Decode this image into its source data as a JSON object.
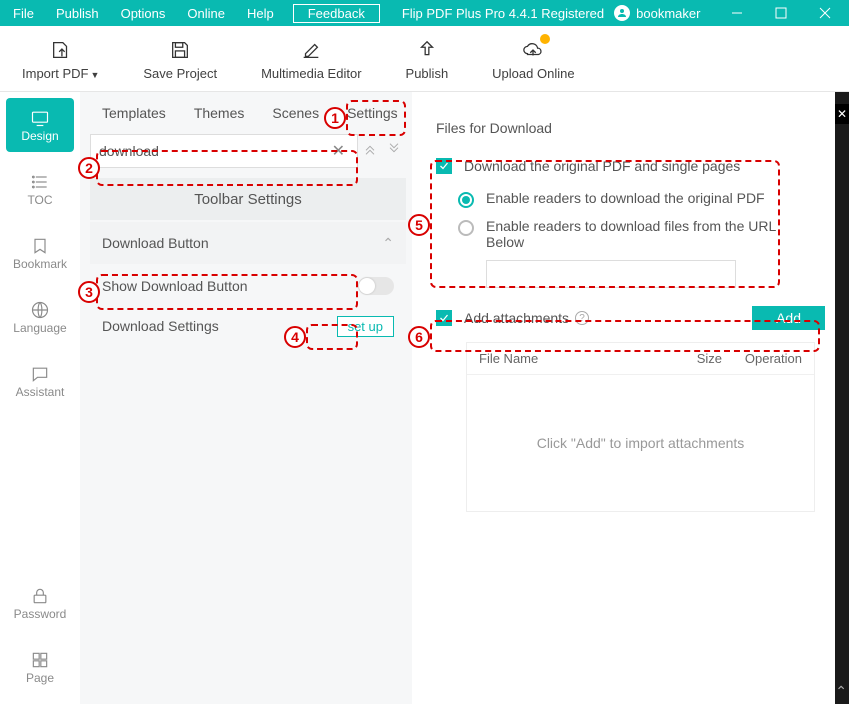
{
  "titlebar": {
    "menus": {
      "file": "File",
      "publish": "Publish",
      "options": "Options",
      "online": "Online",
      "help": "Help"
    },
    "feedback": "Feedback",
    "apptitle": "Flip PDF Plus Pro 4.4.1 Registered",
    "user": "bookmaker"
  },
  "toolbar": {
    "import": "Import PDF",
    "save": "Save Project",
    "multimedia": "Multimedia Editor",
    "publish": "Publish",
    "upload": "Upload Online"
  },
  "sidebar": {
    "design": "Design",
    "toc": "TOC",
    "bookmark": "Bookmark",
    "language": "Language",
    "assistant": "Assistant",
    "password": "Password",
    "page": "Page"
  },
  "tabs": {
    "templates": "Templates",
    "themes": "Themes",
    "scenes": "Scenes",
    "settings": "Settings"
  },
  "search": {
    "value": "download"
  },
  "mid": {
    "toolbar_settings": "Toolbar Settings",
    "download_button": "Download Button",
    "show_dl": "Show Download Button",
    "dl_settings": "Download Settings",
    "setup": "set up"
  },
  "right": {
    "title": "Files for Download",
    "chk1": "Download the original PDF and single pages",
    "r1": "Enable readers to download the original PDF",
    "r2": "Enable readers to download files from the URL",
    "r2b": "Below",
    "chk2": "Add attachments",
    "add": "Add",
    "col_file": "File Name",
    "col_size": "Size",
    "col_op": "Operation",
    "empty": "Click \"Add\" to import attachments"
  }
}
